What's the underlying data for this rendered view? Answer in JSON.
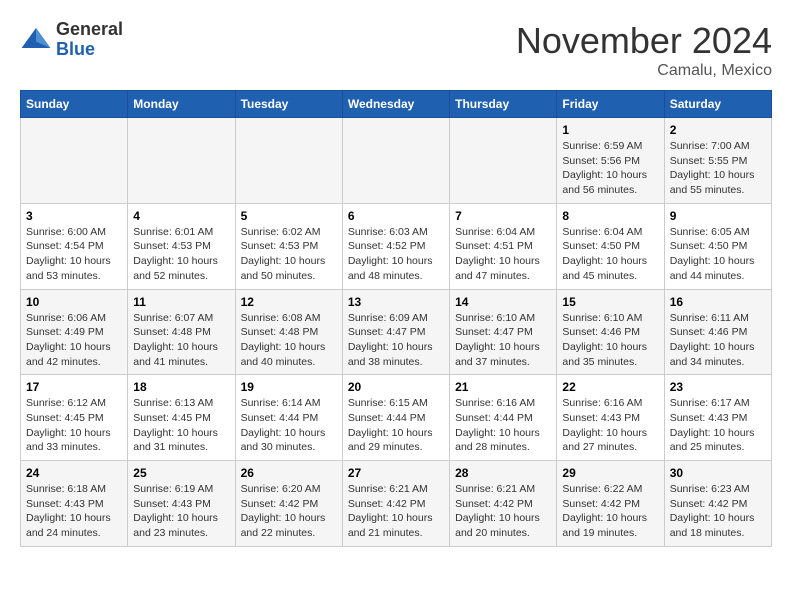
{
  "logo": {
    "general": "General",
    "blue": "Blue"
  },
  "title": "November 2024",
  "location": "Camalu, Mexico",
  "days_of_week": [
    "Sunday",
    "Monday",
    "Tuesday",
    "Wednesday",
    "Thursday",
    "Friday",
    "Saturday"
  ],
  "weeks": [
    [
      {
        "day": "",
        "info": ""
      },
      {
        "day": "",
        "info": ""
      },
      {
        "day": "",
        "info": ""
      },
      {
        "day": "",
        "info": ""
      },
      {
        "day": "",
        "info": ""
      },
      {
        "day": "1",
        "info": "Sunrise: 6:59 AM\nSunset: 5:56 PM\nDaylight: 10 hours and 56 minutes."
      },
      {
        "day": "2",
        "info": "Sunrise: 7:00 AM\nSunset: 5:55 PM\nDaylight: 10 hours and 55 minutes."
      }
    ],
    [
      {
        "day": "3",
        "info": "Sunrise: 6:00 AM\nSunset: 4:54 PM\nDaylight: 10 hours and 53 minutes."
      },
      {
        "day": "4",
        "info": "Sunrise: 6:01 AM\nSunset: 4:53 PM\nDaylight: 10 hours and 52 minutes."
      },
      {
        "day": "5",
        "info": "Sunrise: 6:02 AM\nSunset: 4:53 PM\nDaylight: 10 hours and 50 minutes."
      },
      {
        "day": "6",
        "info": "Sunrise: 6:03 AM\nSunset: 4:52 PM\nDaylight: 10 hours and 48 minutes."
      },
      {
        "day": "7",
        "info": "Sunrise: 6:04 AM\nSunset: 4:51 PM\nDaylight: 10 hours and 47 minutes."
      },
      {
        "day": "8",
        "info": "Sunrise: 6:04 AM\nSunset: 4:50 PM\nDaylight: 10 hours and 45 minutes."
      },
      {
        "day": "9",
        "info": "Sunrise: 6:05 AM\nSunset: 4:50 PM\nDaylight: 10 hours and 44 minutes."
      }
    ],
    [
      {
        "day": "10",
        "info": "Sunrise: 6:06 AM\nSunset: 4:49 PM\nDaylight: 10 hours and 42 minutes."
      },
      {
        "day": "11",
        "info": "Sunrise: 6:07 AM\nSunset: 4:48 PM\nDaylight: 10 hours and 41 minutes."
      },
      {
        "day": "12",
        "info": "Sunrise: 6:08 AM\nSunset: 4:48 PM\nDaylight: 10 hours and 40 minutes."
      },
      {
        "day": "13",
        "info": "Sunrise: 6:09 AM\nSunset: 4:47 PM\nDaylight: 10 hours and 38 minutes."
      },
      {
        "day": "14",
        "info": "Sunrise: 6:10 AM\nSunset: 4:47 PM\nDaylight: 10 hours and 37 minutes."
      },
      {
        "day": "15",
        "info": "Sunrise: 6:10 AM\nSunset: 4:46 PM\nDaylight: 10 hours and 35 minutes."
      },
      {
        "day": "16",
        "info": "Sunrise: 6:11 AM\nSunset: 4:46 PM\nDaylight: 10 hours and 34 minutes."
      }
    ],
    [
      {
        "day": "17",
        "info": "Sunrise: 6:12 AM\nSunset: 4:45 PM\nDaylight: 10 hours and 33 minutes."
      },
      {
        "day": "18",
        "info": "Sunrise: 6:13 AM\nSunset: 4:45 PM\nDaylight: 10 hours and 31 minutes."
      },
      {
        "day": "19",
        "info": "Sunrise: 6:14 AM\nSunset: 4:44 PM\nDaylight: 10 hours and 30 minutes."
      },
      {
        "day": "20",
        "info": "Sunrise: 6:15 AM\nSunset: 4:44 PM\nDaylight: 10 hours and 29 minutes."
      },
      {
        "day": "21",
        "info": "Sunrise: 6:16 AM\nSunset: 4:44 PM\nDaylight: 10 hours and 28 minutes."
      },
      {
        "day": "22",
        "info": "Sunrise: 6:16 AM\nSunset: 4:43 PM\nDaylight: 10 hours and 27 minutes."
      },
      {
        "day": "23",
        "info": "Sunrise: 6:17 AM\nSunset: 4:43 PM\nDaylight: 10 hours and 25 minutes."
      }
    ],
    [
      {
        "day": "24",
        "info": "Sunrise: 6:18 AM\nSunset: 4:43 PM\nDaylight: 10 hours and 24 minutes."
      },
      {
        "day": "25",
        "info": "Sunrise: 6:19 AM\nSunset: 4:43 PM\nDaylight: 10 hours and 23 minutes."
      },
      {
        "day": "26",
        "info": "Sunrise: 6:20 AM\nSunset: 4:42 PM\nDaylight: 10 hours and 22 minutes."
      },
      {
        "day": "27",
        "info": "Sunrise: 6:21 AM\nSunset: 4:42 PM\nDaylight: 10 hours and 21 minutes."
      },
      {
        "day": "28",
        "info": "Sunrise: 6:21 AM\nSunset: 4:42 PM\nDaylight: 10 hours and 20 minutes."
      },
      {
        "day": "29",
        "info": "Sunrise: 6:22 AM\nSunset: 4:42 PM\nDaylight: 10 hours and 19 minutes."
      },
      {
        "day": "30",
        "info": "Sunrise: 6:23 AM\nSunset: 4:42 PM\nDaylight: 10 hours and 18 minutes."
      }
    ]
  ]
}
